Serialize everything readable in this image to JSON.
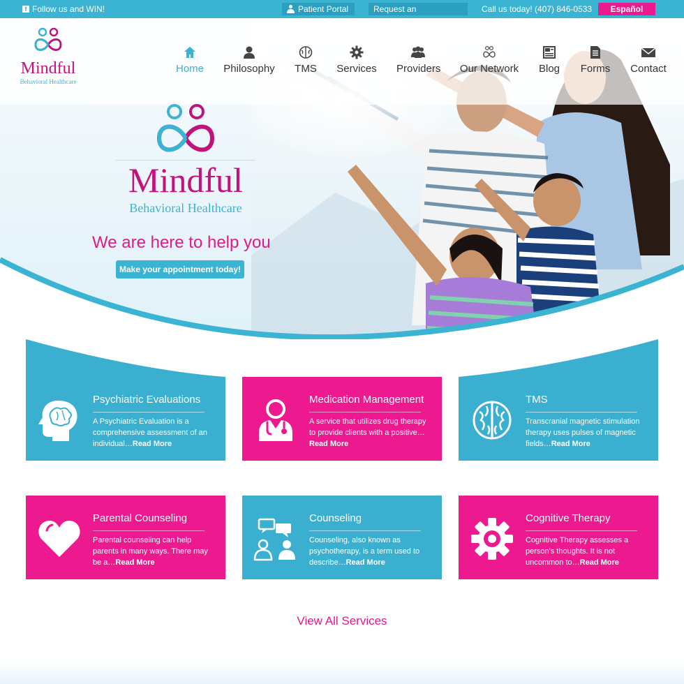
{
  "topbar": {
    "follow": "Follow us and WIN!",
    "portal": "Patient Portal",
    "request": "Request an Appointment",
    "call": "Call us today! (407) 846-0533",
    "espanol": "Español"
  },
  "logo": {
    "word": "Mindful",
    "sub": "Behavioral Healthcare"
  },
  "nav": [
    {
      "label": "Home",
      "icon": "home-icon",
      "active": true
    },
    {
      "label": "Philosophy",
      "icon": "person-icon"
    },
    {
      "label": "TMS",
      "icon": "brain-icon"
    },
    {
      "label": "Services",
      "icon": "gear-icon"
    },
    {
      "label": "Providers",
      "icon": "group-icon"
    },
    {
      "label": "Our Network",
      "icon": "network-icon"
    },
    {
      "label": "Blog",
      "icon": "blog-icon"
    },
    {
      "label": "Forms",
      "icon": "document-icon"
    },
    {
      "label": "Contact",
      "icon": "envelope-icon"
    }
  ],
  "hero": {
    "tagline": "We are here to help you",
    "button": "Make your appointment today!"
  },
  "services": [
    {
      "title": "Psychiatric Evaluations",
      "text": "A Psychiatric Evaluation is a comprehensive assessment of an individual…",
      "more": "Read More",
      "color": "#3bafcf",
      "icon": "head-brain-icon"
    },
    {
      "title": "Medication Management",
      "text": "A service that utilizes drug therapy to provide clients with a positive…",
      "more": "Read More",
      "color": "#ec1a8e",
      "icon": "doctor-icon"
    },
    {
      "title": "TMS",
      "text": "Transcranial magnetic stimulation therapy uses pulses of magnetic fields…",
      "more": "Read More",
      "color": "#3bafcf",
      "icon": "brain-icon"
    },
    {
      "title": "Parental Counseling",
      "text": "Parental counseling can help parents in many ways. There may be a…",
      "more": "Read More",
      "color": "#ec1a8e",
      "icon": "heart-icon"
    },
    {
      "title": "Counseling",
      "text": "Counseling, also known as psychotherapy, is a term used to describe…",
      "more": "Read More",
      "color": "#3bafcf",
      "icon": "conversation-icon"
    },
    {
      "title": "Cognitive Therapy",
      "text": "Cognitive Therapy assesses a person's thoughts. It is not uncommon to…",
      "more": "Read More",
      "color": "#ec1a8e",
      "icon": "cog-icon"
    }
  ],
  "view_all": "View All Services",
  "colors": {
    "teal": "#3bb3d3",
    "pink": "#ec1a8e",
    "magenta": "#c2127c"
  }
}
